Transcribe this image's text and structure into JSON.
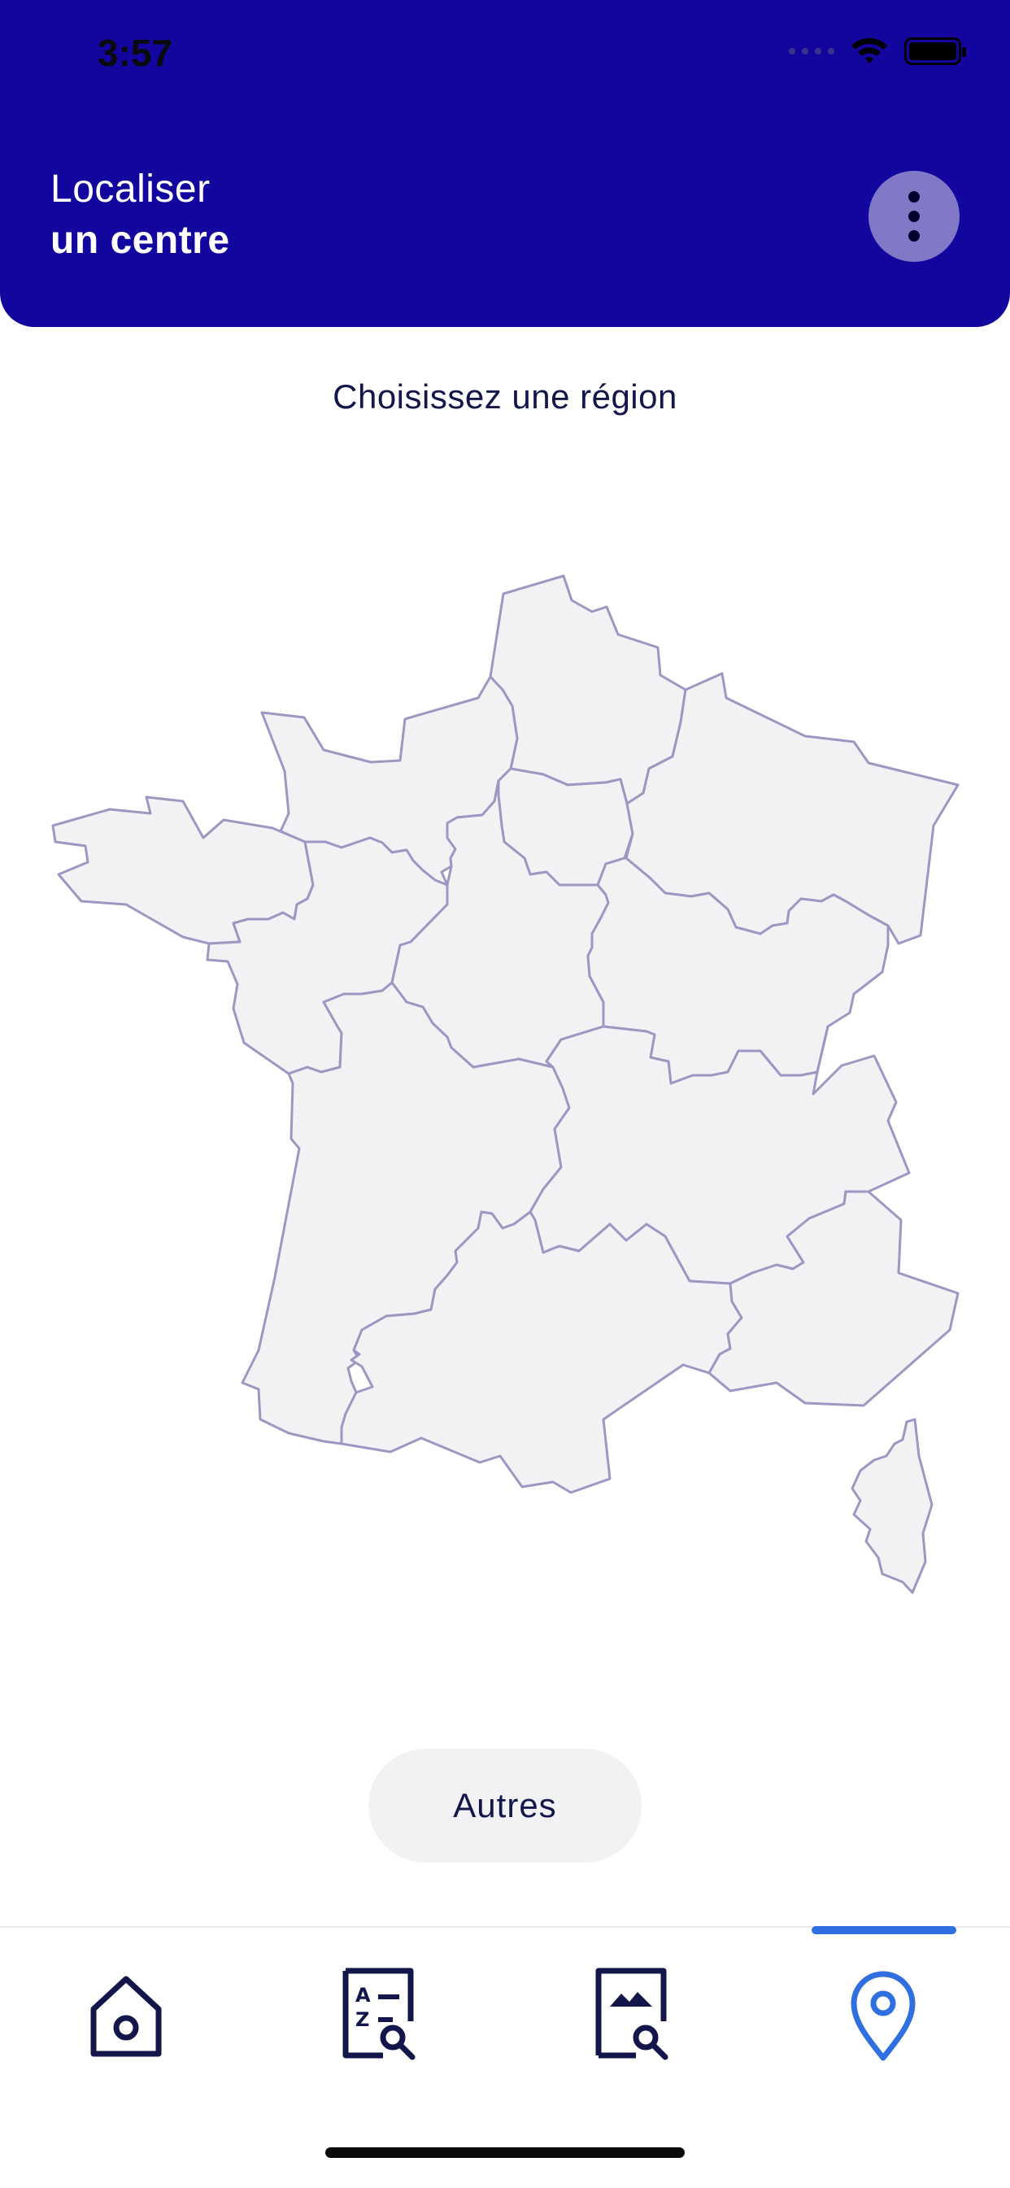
{
  "status_bar": {
    "time": "3:57"
  },
  "header": {
    "title_line1": "Localiser",
    "title_line2": "un centre",
    "menu_icon": "more-vertical-icon"
  },
  "main": {
    "instruction": "Choisissez une région",
    "regions": [
      "Hauts-de-France",
      "Normandie",
      "Île-de-France",
      "Grand Est",
      "Bretagne",
      "Pays de la Loire",
      "Centre-Val de Loire",
      "Bourgogne-Franche-Comté",
      "Nouvelle-Aquitaine",
      "Auvergne-Rhône-Alpes",
      "Occitanie",
      "Provence-Alpes-Côte d'Azur",
      "Corse"
    ],
    "other_button": "Autres"
  },
  "tabbar": {
    "tabs": [
      {
        "icon": "home-icon",
        "active": false
      },
      {
        "icon": "glossary-search-icon",
        "active": false
      },
      {
        "icon": "image-search-icon",
        "active": false
      },
      {
        "icon": "location-pin-icon",
        "active": true
      }
    ]
  },
  "colors": {
    "header": "#13069f",
    "text_dark": "#13164a",
    "region_fill": "#f2f2f5",
    "region_stroke": "#9b98c2",
    "active_tab": "#2f6fe0"
  }
}
